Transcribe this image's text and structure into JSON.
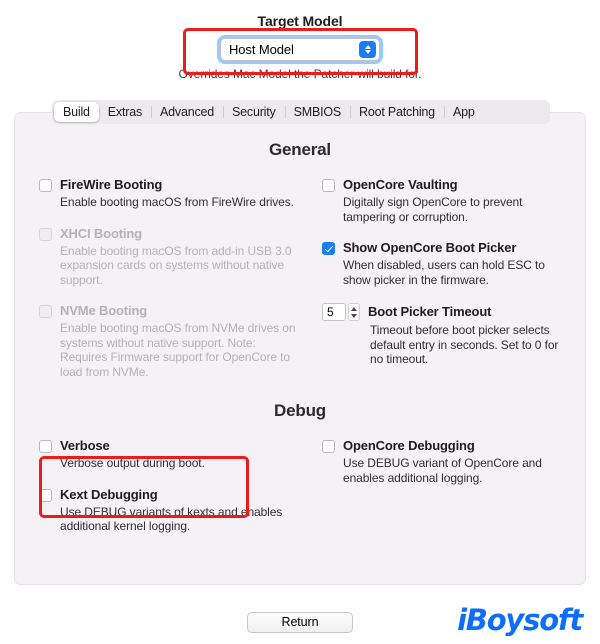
{
  "header": {
    "target_model_title": "Target Model",
    "selected_model": "Host Model",
    "overrides_note": "Overrides Mac Model the Patcher will build for.",
    "dropdown_icon": "up-down-chevron-icon"
  },
  "tabs": [
    {
      "label": "Build",
      "active": true
    },
    {
      "label": "Extras",
      "active": false
    },
    {
      "label": "Advanced",
      "active": false
    },
    {
      "label": "Security",
      "active": false
    },
    {
      "label": "SMBIOS",
      "active": false
    },
    {
      "label": "Root Patching",
      "active": false
    },
    {
      "label": "App",
      "active": false
    }
  ],
  "sections": {
    "general_title": "General",
    "debug_title": "Debug"
  },
  "general": {
    "left": [
      {
        "label": "FireWire Booting",
        "desc": "Enable booting macOS from FireWire drives.",
        "checked": false,
        "disabled": false
      },
      {
        "label": "XHCI Booting",
        "desc": "Enable booting macOS from add-in USB 3.0 expansion cards on systems without native support.",
        "checked": false,
        "disabled": true
      },
      {
        "label": "NVMe Booting",
        "desc": "Enable booting macOS from NVMe drives on systems without native support.\nNote: Requires Firmware support for OpenCore to load from NVMe.",
        "checked": false,
        "disabled": true
      }
    ],
    "right": [
      {
        "label": "OpenCore Vaulting",
        "desc": "Digitally sign OpenCore to prevent tampering or corruption.",
        "checked": false,
        "disabled": false
      },
      {
        "label": "Show OpenCore Boot Picker",
        "desc": "When disabled, users can hold ESC to show picker in the firmware.",
        "checked": true,
        "disabled": false
      }
    ],
    "boot_picker_timeout": {
      "label": "Boot Picker Timeout",
      "value": "5",
      "desc": "Timeout before boot picker selects default entry in seconds.\nSet to 0 for no timeout.",
      "stepper_icon": "stepper-arrows-icon"
    }
  },
  "debug": {
    "left": [
      {
        "label": "Verbose",
        "desc": "Verbose output during boot.",
        "checked": false,
        "disabled": false
      },
      {
        "label": "Kext Debugging",
        "desc": "Use DEBUG variants of kexts and enables additional kernel logging.",
        "checked": false,
        "disabled": false
      }
    ],
    "right": [
      {
        "label": "OpenCore Debugging",
        "desc": "Use DEBUG variant of OpenCore and enables additional logging.",
        "checked": false,
        "disabled": false
      }
    ]
  },
  "footer": {
    "return_label": "Return",
    "watermark": "iBoysoft"
  },
  "annotations": {
    "accent_red": "#ef1b1b",
    "accent_blue": "#1b7df5"
  }
}
